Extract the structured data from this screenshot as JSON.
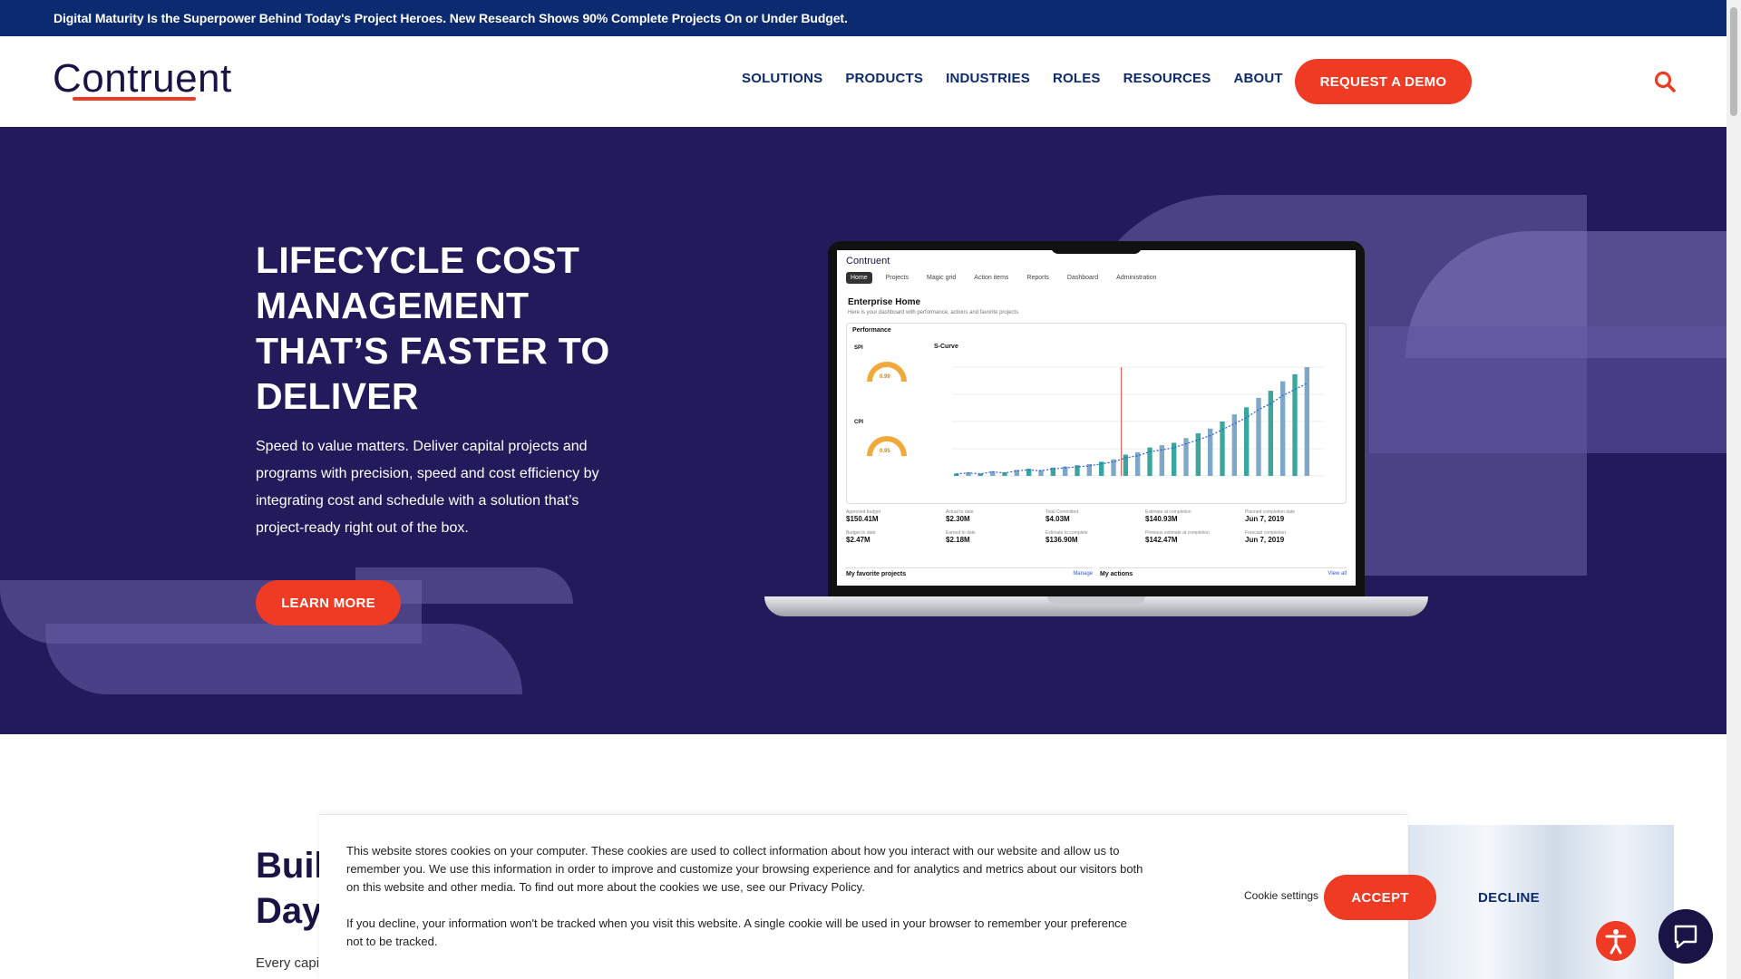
{
  "announcement": "Digital Maturity Is the Superpower Behind Today's Project Heroes. New Research Shows 90% Complete Projects On or Under Budget.",
  "header": {
    "logo": "Contruent",
    "nav": [
      "SOLUTIONS",
      "PRODUCTS",
      "INDUSTRIES",
      "ROLES",
      "RESOURCES",
      "ABOUT"
    ],
    "cta": "REQUEST A DEMO"
  },
  "hero": {
    "title": "LIFECYCLE COST MANAGEMENT THAT’S FASTER TO DELIVER",
    "text": "Speed to value matters. Deliver capital projects and programs with precision, speed and cost efficiency by integrating cost and schedule with a solution that’s project-ready right out of the box.",
    "button": "LEARN MORE"
  },
  "screen": {
    "logo": "Contruent",
    "tabs": [
      "Home",
      "Projects",
      "Magic grid",
      "Action items",
      "Reports",
      "Dashboard",
      "Administration"
    ],
    "heading": "Enterprise Home",
    "subheading": "Here is your dashboard with performance, actions and favorite projects",
    "performance": "Performance",
    "scurve": "S-Curve",
    "spi_label": "SPI",
    "spi_value": "0.99",
    "cpi_label": "CPI",
    "cpi_value": "0.95",
    "metrics_row1": [
      {
        "label": "Approved budget",
        "value": "$150.41M"
      },
      {
        "label": "Actual to date",
        "value": "$2.30M"
      },
      {
        "label": "Total Committed",
        "value": "$4.03M"
      },
      {
        "label": "Estimate at completion",
        "value": "$140.93M"
      },
      {
        "label": "Planned completion date",
        "value": "Jun 7, 2019"
      }
    ],
    "metrics_row2": [
      {
        "label": "Budget to date",
        "value": "$2.47M"
      },
      {
        "label": "Earned to date",
        "value": "$2.18M"
      },
      {
        "label": "Estimate to complete",
        "value": "$136.90M"
      },
      {
        "label": "Previous estimate at completion",
        "value": "$142.47M"
      },
      {
        "label": "Forecast completion",
        "value": "Jun 7, 2019"
      }
    ],
    "favorites": "My favorite projects",
    "favorites_link": "Manage",
    "actions": "My actions",
    "actions_link": "View all",
    "bars": [
      2,
      3,
      2,
      4,
      3,
      5,
      6,
      5,
      7,
      8,
      9,
      10,
      12,
      14,
      18,
      20,
      24,
      26,
      28,
      32,
      36,
      40,
      46,
      52,
      58,
      66,
      72,
      80,
      86,
      92
    ]
  },
  "section": {
    "title_line1": "Buil",
    "title_line2": "Day",
    "text": "Every capi"
  },
  "cookie": {
    "p1": "This website stores cookies on your computer. These cookies are used to collect information about how you interact with our website and allow us to remember you. We use this information in order to improve and customize your browsing experience and for analytics and metrics about our visitors both on this website and other media. To find out more about the cookies we use, see our Privacy Policy.",
    "p2": "If you decline, your information won't be tracked when you visit this website. A single cookie will be used in your browser to remember your preference not to be tracked.",
    "settings": "Cookie settings",
    "accept": "ACCEPT",
    "decline": "DECLINE"
  },
  "colors": {
    "navy": "#0b2a6f",
    "hero_bg": "#231a5c",
    "accent": "#ef3b24"
  },
  "icons": [
    "search-icon",
    "accessibility-icon",
    "chat-icon"
  ]
}
